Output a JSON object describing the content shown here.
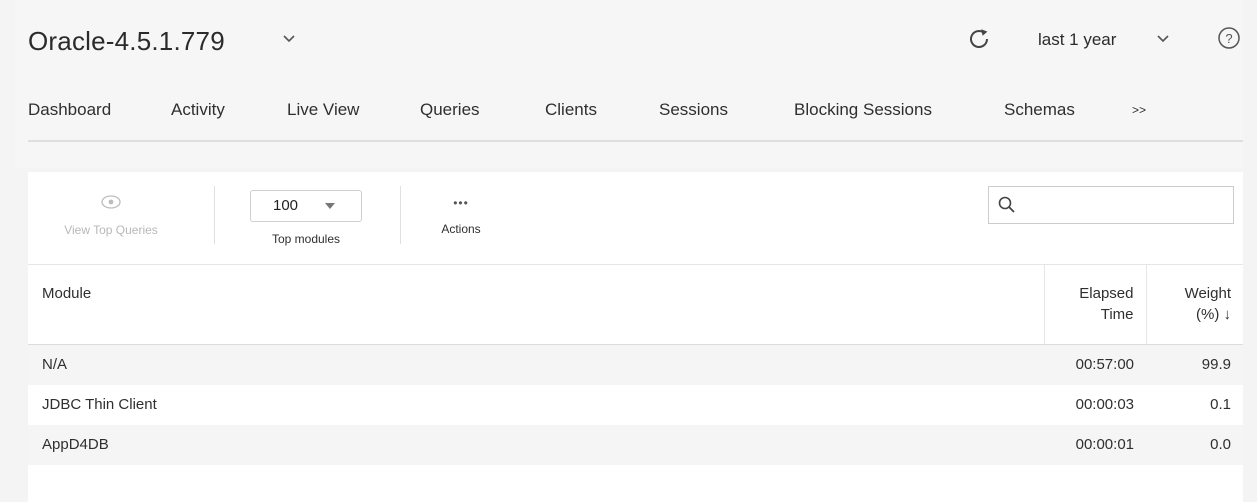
{
  "header": {
    "title": "Oracle-4.5.1.779",
    "time_range": "last 1 year"
  },
  "tabs": [
    {
      "label": "Dashboard"
    },
    {
      "label": "Activity"
    },
    {
      "label": "Live View"
    },
    {
      "label": "Queries"
    },
    {
      "label": "Clients"
    },
    {
      "label": "Sessions"
    },
    {
      "label": "Blocking Sessions"
    },
    {
      "label": "Schemas"
    },
    {
      "label": ">>"
    }
  ],
  "toolbar": {
    "view_top_queries_label": "View Top Queries",
    "top_count_value": "100",
    "top_modules_label": "Top modules",
    "actions_icon": "•••",
    "actions_label": "Actions",
    "search_value": "",
    "search_placeholder": ""
  },
  "table": {
    "columns": {
      "module": "Module",
      "elapsed_line1": "Elapsed",
      "elapsed_line2": "Time",
      "weight_line1": "Weight",
      "weight_line2": "(%) ↓"
    },
    "rows": [
      {
        "module": "N/A",
        "elapsed": "00:57:00",
        "weight": "99.9"
      },
      {
        "module": "JDBC Thin Client",
        "elapsed": "00:00:03",
        "weight": "0.1"
      },
      {
        "module": "AppD4DB",
        "elapsed": "00:00:01",
        "weight": "0.0"
      }
    ]
  },
  "icons": {
    "title_dropdown": "chevron-down-icon",
    "refresh": "refresh-icon",
    "range_dropdown": "chevron-down-icon",
    "help": "help-circle-icon",
    "view": "eye-icon",
    "search": "search-icon"
  }
}
